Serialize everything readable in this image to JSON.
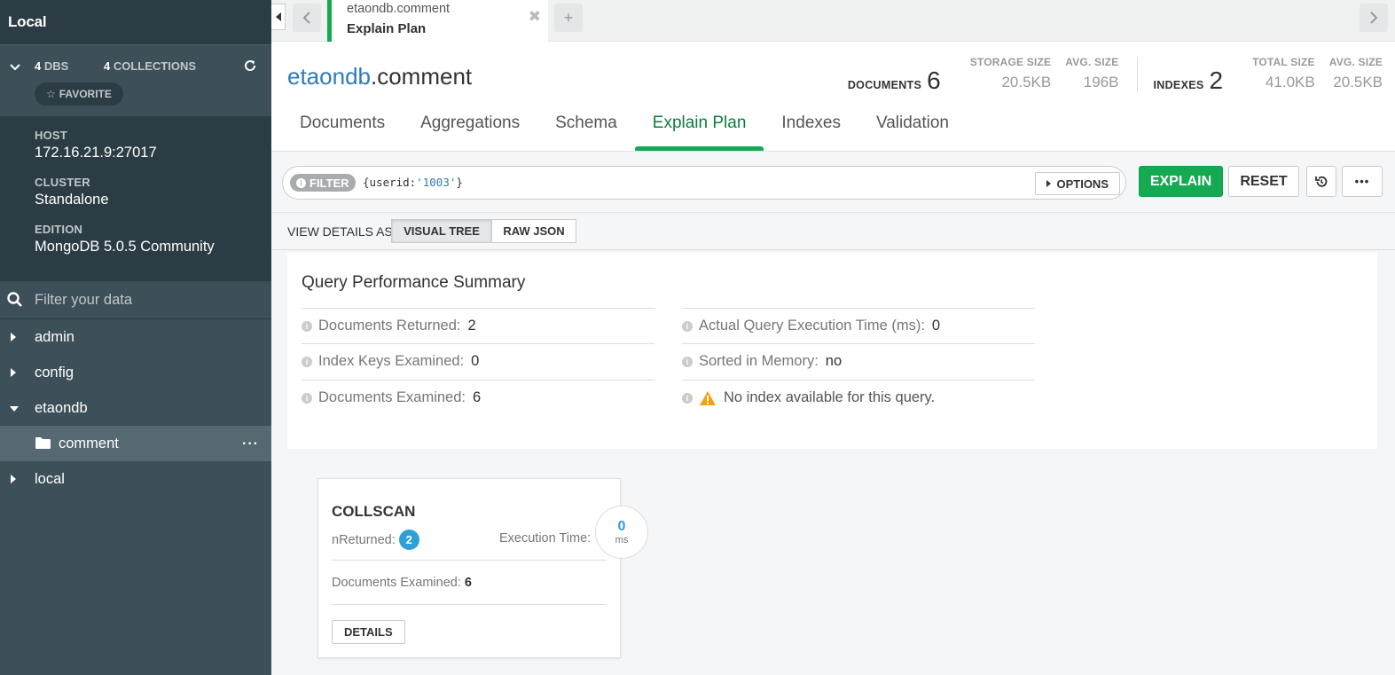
{
  "sidebar": {
    "title": "Local",
    "dbs_count": "4",
    "dbs_label": "DBS",
    "collections_count": "4",
    "collections_label": "COLLECTIONS",
    "favorite_label": "FAVORITE",
    "host_label": "HOST",
    "host_value": "172.16.21.9:27017",
    "cluster_label": "CLUSTER",
    "cluster_value": "Standalone",
    "edition_label": "EDITION",
    "edition_value": "MongoDB 5.0.5 Community",
    "filter_placeholder": "Filter your data",
    "databases": [
      {
        "label": "admin"
      },
      {
        "label": "config"
      },
      {
        "label": "etaondb"
      },
      {
        "label": "local"
      }
    ],
    "active_collection": "comment"
  },
  "tab": {
    "namespace": "etaondb.comment",
    "subtitle": "Explain Plan",
    "add": "+"
  },
  "header": {
    "db": "etaondb",
    "collection": ".comment",
    "documents_label": "DOCUMENTS",
    "documents_value": "6",
    "storage_size_label": "STORAGE SIZE",
    "storage_size_value": "20.5KB",
    "avg_size_label": "AVG. SIZE",
    "avg_size_value": "196B",
    "indexes_label": "INDEXES",
    "indexes_value": "2",
    "total_size_label": "TOTAL SIZE",
    "total_size_value": "41.0KB",
    "idx_avg_size_label": "AVG. SIZE",
    "idx_avg_size_value": "20.5KB"
  },
  "nav_tabs": [
    {
      "label": "Documents"
    },
    {
      "label": "Aggregations"
    },
    {
      "label": "Schema"
    },
    {
      "label": "Explain Plan"
    },
    {
      "label": "Indexes"
    },
    {
      "label": "Validation"
    }
  ],
  "query": {
    "filter_label": "FILTER",
    "key": "{userid:",
    "value": "'1003'",
    "close": "}",
    "options_label": "OPTIONS",
    "explain_label": "EXPLAIN",
    "reset_label": "RESET",
    "more": "•••"
  },
  "view": {
    "label": "VIEW DETAILS AS",
    "visual_tree": "VISUAL TREE",
    "raw_json": "RAW JSON"
  },
  "summary": {
    "title": "Query Performance Summary",
    "docs_returned_label": "Documents Returned:",
    "docs_returned_value": "2",
    "index_keys_label": "Index Keys Examined:",
    "index_keys_value": "0",
    "docs_examined_label": "Documents Examined:",
    "docs_examined_value": "6",
    "exec_time_label": "Actual Query Execution Time (ms):",
    "exec_time_value": "0",
    "sorted_label": "Sorted in Memory:",
    "sorted_value": "no",
    "warning": "No index available for this query."
  },
  "stage": {
    "name": "COLLSCAN",
    "nreturned_label": "nReturned:",
    "nreturned_value": "2",
    "exec_time_label": "Execution Time:",
    "exec_time_value": "0",
    "exec_time_unit": "ms",
    "docs_examined_label": "Documents Examined:",
    "docs_examined_value": "6",
    "details_label": "DETAILS"
  },
  "colors": {
    "accent": "#13aa52",
    "sidebar": "#3d4f58",
    "link": "#2d7bba"
  }
}
